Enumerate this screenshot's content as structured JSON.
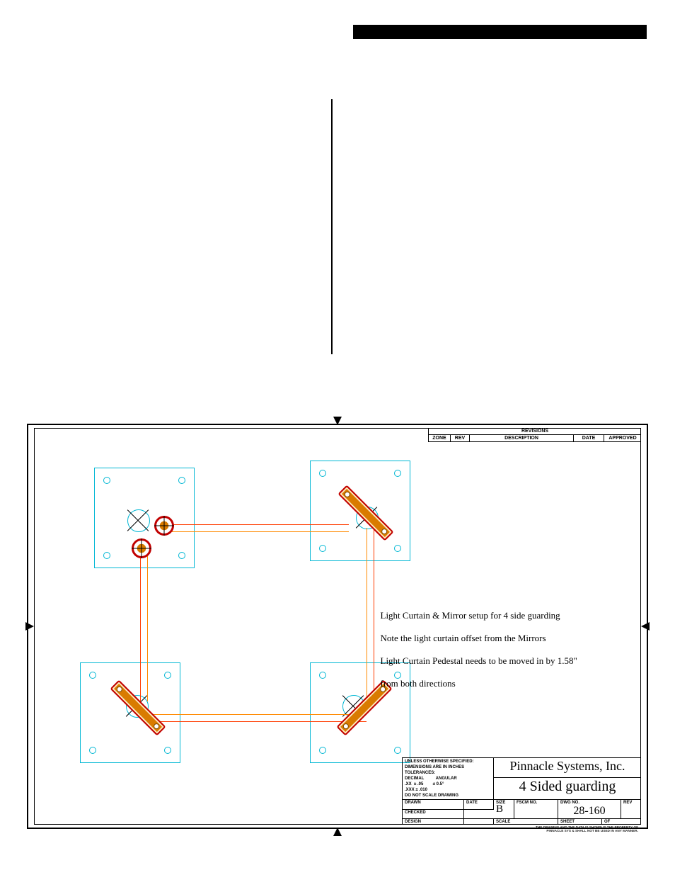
{
  "revisions": {
    "title": "REVISIONS",
    "cols": {
      "zone": "ZONE",
      "rev": "REV",
      "desc": "DESCRIPTION",
      "date": "DATE",
      "approved": "APPROVED"
    }
  },
  "note": {
    "l1": "Light Curtain & Mirror setup for 4 side guarding",
    "l2": "Note the light curtain offset from the Mirrors",
    "l3": "Light Curtain Pedestal needs to be moved in by 1.58\"",
    "l4": "from both directions"
  },
  "titleblock": {
    "spec": "UNLESS OTHERWISE SPECIFIED:\nDIMENSIONS ARE IN INCHES\nTOLERANCES:\nDECIMAL          ANGULAR\n.XX  ± .05        ± 0.5°\n.XXX ± .010\nDO NOT SCALE DRAWING",
    "company": "Pinnacle Systems, Inc.",
    "title": "4 Sided guarding",
    "drawn": "DRAWN",
    "date": "DATE",
    "checked": "CHECKED",
    "design": "DESIGN",
    "size_lab": "SIZE",
    "size_val": "B",
    "fscm": "FSCM NO.",
    "dwgno_lab": "DWG NO.",
    "dwgno": "28-160",
    "rev": "REV",
    "scale": "SCALE",
    "sheet": "SHEET",
    "of": "OF"
  },
  "fineprint": "THE DRAWING AND THE DATA IS SHOWN IS THE PROPERTY OF\nPINNACLE SYS & SHALL NOT BE USED IN ANY MANNER."
}
